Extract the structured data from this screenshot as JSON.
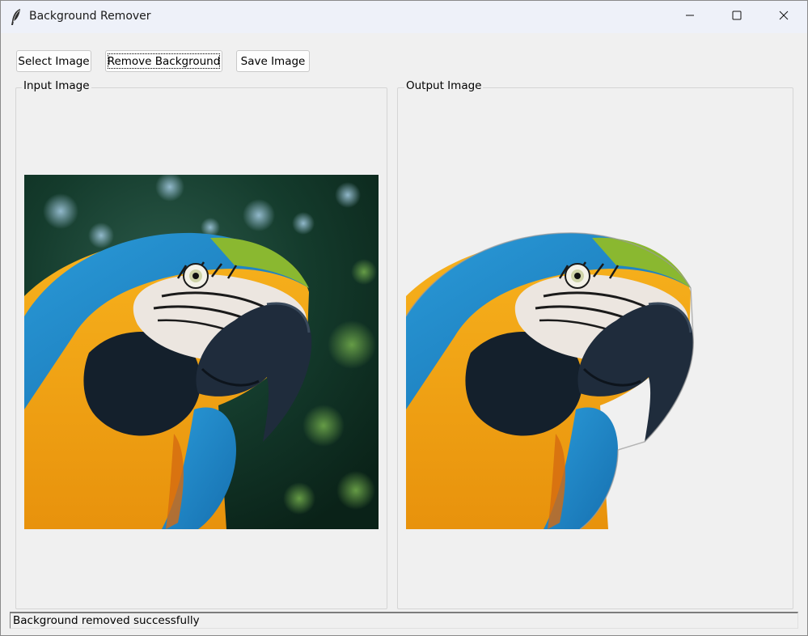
{
  "window": {
    "title": "Background Remover",
    "icon": "feather-icon",
    "controls": [
      "minimize-icon",
      "maximize-icon",
      "close-icon"
    ]
  },
  "toolbar": {
    "select_label": "Select Image",
    "remove_label": "Remove Background",
    "save_label": "Save Image"
  },
  "panels": {
    "input_label": "Input Image",
    "output_label": "Output Image",
    "input_image": "macaw-parrot-photo",
    "output_image": "macaw-parrot-background-removed"
  },
  "status": {
    "text": "Background removed successfully"
  },
  "colors": {
    "window_bg": "#f0f0f0",
    "titlebar_bg": "#eef1f9",
    "parrot_blue": "#1f86c8",
    "parrot_yellow": "#f2a818",
    "foliage_dark": "#0c2a1e"
  }
}
